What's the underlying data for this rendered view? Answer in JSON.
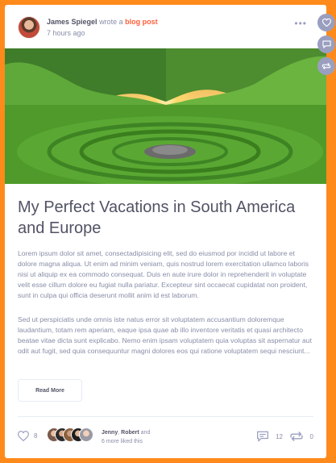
{
  "post": {
    "author_name": "James Spiegel",
    "wrote_a": "wrote a",
    "post_type": "blog post",
    "time": "7 hours ago",
    "more_icon": "more-dots-icon",
    "title": "My Perfect Vacations in South America and Europe",
    "paragraph_1": "Lorem ipsum dolor sit amet, consectadipisicing elit, sed do eiusmod por incidid ut labore et dolore magna aliqua. Ut enim ad minim veniam, quis nostrud lorem exercitation ullamco laboris nisi ut aliquip ex ea commodo consequat. Duis en aute irure dolor in reprehenderit in voluptate velit esse cillum dolore eu fugiat nulla pariatur. Excepteur sint occaecat cupidatat non proident, sunt in culpa qui officia deserunt mollit anim id est laborum.",
    "paragraph_2": "Sed ut perspiciatis unde omnis iste natus error sit voluptatem accusantium doloremque laudantium, totam rem aperiam, eaque ipsa quae ab illo inventore veritatis et quasi architecto beatae vitae dicta sunt explicabo. Nemo enim ipsam voluptatem quia voluptas sit aspernatur aut odit aut fugit, sed quia consequuntur magni dolores eos qui ratione voluptatem sequi nesciunt...",
    "read_more_label": "Read More"
  },
  "footer": {
    "like_count": "8",
    "liker_1": "Jenny",
    "liker_separator": ",",
    "liker_2": "Robert",
    "and_word": "and",
    "more_liked": "6 more liked this",
    "comment_count": "12",
    "share_count": "0"
  },
  "colors": {
    "page_background": "#ff8a1c",
    "accent": "#ff5e3a",
    "icon_gray": "#9a9fbf",
    "text_dark": "#515365",
    "text_light": "#888da8"
  },
  "side_actions": [
    "heart-icon",
    "comment-icon",
    "share-icon"
  ]
}
